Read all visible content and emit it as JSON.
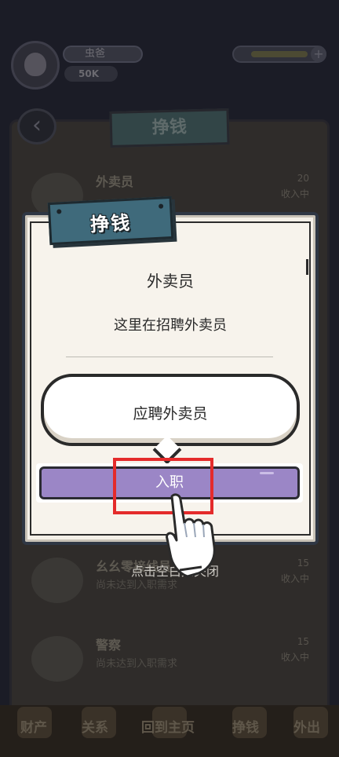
{
  "header": {
    "player_name": "虫爸",
    "money": "50K"
  },
  "page": {
    "title": "挣钱"
  },
  "background_jobs": [
    {
      "name": "外卖员",
      "value": "20",
      "label": "收入中"
    },
    {
      "name": "幺幺零接线员",
      "sub": "尚未达到入职需求",
      "value": "15",
      "label": "收入中"
    },
    {
      "name": "警察",
      "sub": "尚未达到入职需求",
      "value": "15",
      "label": "收入中"
    }
  ],
  "tabs": [
    {
      "label": "财产"
    },
    {
      "label": "关系"
    },
    {
      "label": "回到主页"
    },
    {
      "label": "挣钱"
    },
    {
      "label": "外出"
    }
  ],
  "dialog": {
    "title": "挣钱",
    "job_title": "外卖员",
    "description": "这里在招聘外卖员",
    "bubble_text": "应聘外卖员",
    "hire_button": "入职",
    "tap_hint": "点击空白处关闭"
  },
  "colors": {
    "hire_button": "#9b86c6",
    "highlight": "#e42b2b",
    "title_plate": "#3f6a7b"
  },
  "icons": [
    "back-arrow-icon",
    "pointing-hand-icon"
  ]
}
